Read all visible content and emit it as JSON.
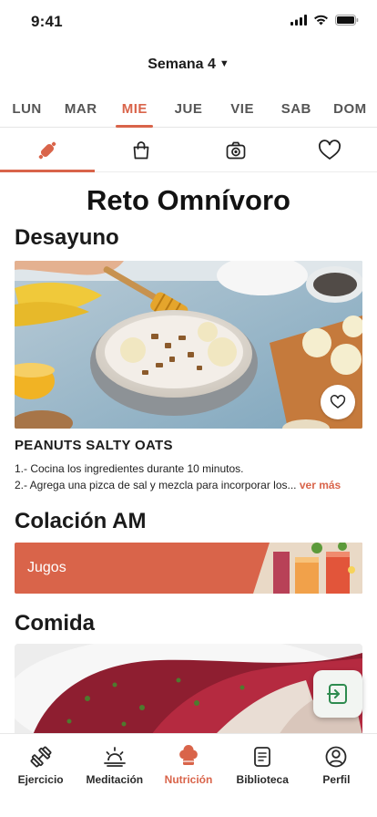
{
  "status": {
    "time": "9:41"
  },
  "week": {
    "label": "Semana 4"
  },
  "days": [
    {
      "label": "LUN"
    },
    {
      "label": "MAR"
    },
    {
      "label": "MIE"
    },
    {
      "label": "JUE"
    },
    {
      "label": "VIE"
    },
    {
      "label": "SAB"
    },
    {
      "label": "DOM"
    }
  ],
  "selected_day": "MIE",
  "categories": [
    {
      "icon": "rolling-pin-icon",
      "active": true
    },
    {
      "icon": "shopping-bag-icon",
      "active": false
    },
    {
      "icon": "camera-icon",
      "active": false
    },
    {
      "icon": "heart-icon",
      "active": false
    }
  ],
  "page": {
    "title": "Reto Omnívoro"
  },
  "breakfast": {
    "section": "Desayuno",
    "recipe_name": "PEANUTS SALTY OATS",
    "step1": "1.- Cocina los ingredientes durante 10 minutos.",
    "step2": "2.- Agrega una pizca de sal y mezcla para incorporar los...",
    "more": "ver más"
  },
  "snack": {
    "section": "Colación AM",
    "item": "Jugos"
  },
  "lunch": {
    "section": "Comida"
  },
  "colors": {
    "accent": "#d9644a",
    "fab_icon": "#2e8b4f"
  },
  "tabbar": [
    {
      "label": "Ejercicio",
      "icon": "dumbbell-icon",
      "active": false
    },
    {
      "label": "Meditación",
      "icon": "sunrise-icon",
      "active": false
    },
    {
      "label": "Nutrición",
      "icon": "chef-hat-icon",
      "active": true
    },
    {
      "label": "Biblioteca",
      "icon": "book-icon",
      "active": false
    },
    {
      "label": "Perfil",
      "icon": "user-icon",
      "active": false
    }
  ]
}
